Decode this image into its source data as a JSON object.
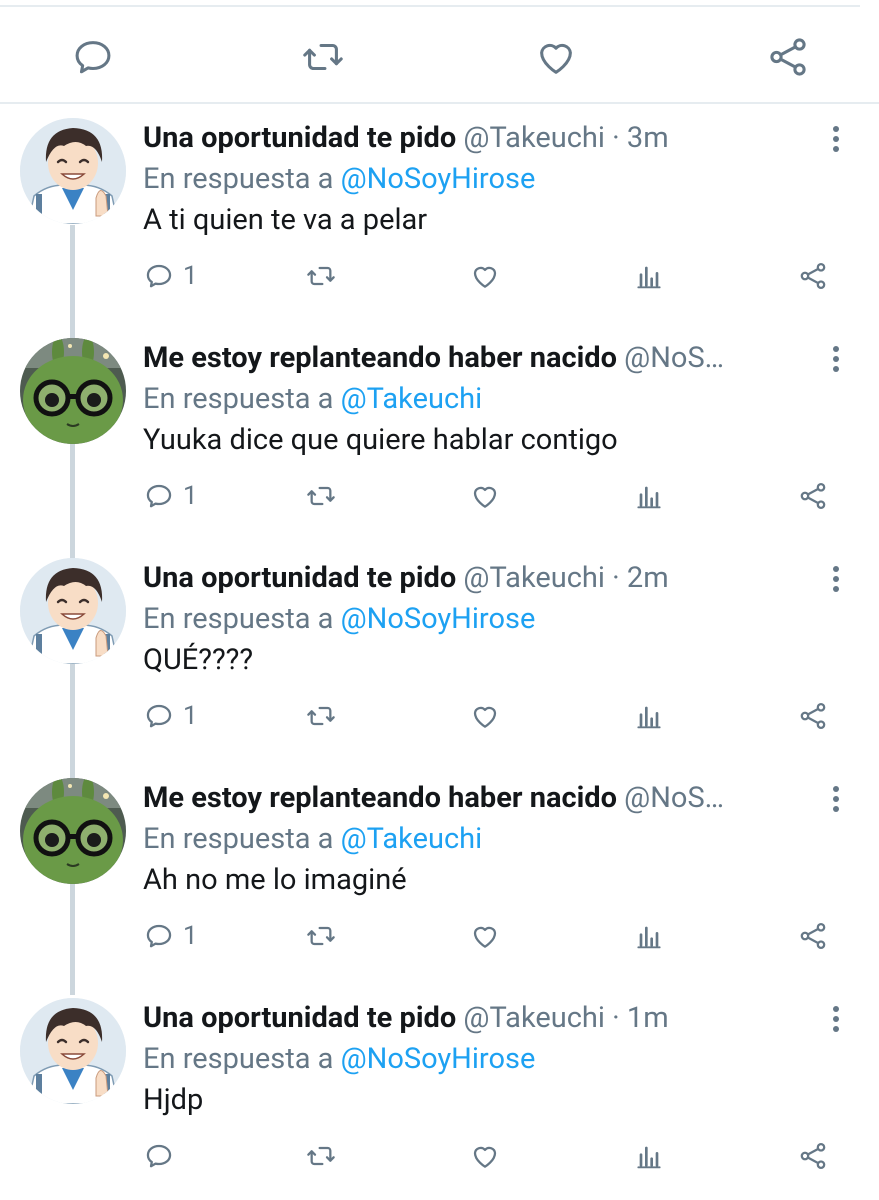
{
  "colors": {
    "accent": "#1da1f2",
    "text": "#14171a",
    "secondary": "#657786",
    "divider": "#e6ecf0",
    "thread_line": "#ccd6dd"
  },
  "top_actions": {
    "icons": [
      "reply-icon",
      "retweet-icon",
      "like-icon",
      "share-icon"
    ]
  },
  "tweets": [
    {
      "avatar": "anime-boy-avatar",
      "name": "Una oportunidad te pido",
      "handle": "@Takeuchi",
      "dot": "·",
      "time": "3m",
      "reply_prefix": "En respuesta a ",
      "reply_mention": "@NoSoyHirose",
      "text": "A ti quien te va a pelar",
      "reply_count": "1"
    },
    {
      "avatar": "green-plush-glasses-avatar",
      "name": "Me estoy replanteando haber nacido",
      "handle": "@NoS…",
      "dot": "",
      "time": "",
      "reply_prefix": "En respuesta a ",
      "reply_mention": "@Takeuchi",
      "text": "Yuuka dice que quiere hablar contigo",
      "reply_count": "1"
    },
    {
      "avatar": "anime-boy-avatar",
      "name": "Una oportunidad te pido",
      "handle": "@Takeuchi",
      "dot": "·",
      "time": "2m",
      "reply_prefix": "En respuesta a ",
      "reply_mention": "@NoSoyHirose",
      "text": "QUÉ????",
      "reply_count": "1"
    },
    {
      "avatar": "green-plush-glasses-avatar",
      "name": "Me estoy replanteando haber nacido",
      "handle": "@NoS…",
      "dot": "",
      "time": "",
      "reply_prefix": "En respuesta a ",
      "reply_mention": "@Takeuchi",
      "text": "Ah no me lo imaginé",
      "reply_count": "1"
    },
    {
      "avatar": "anime-boy-avatar",
      "name": "Una oportunidad te pido",
      "handle": "@Takeuchi",
      "dot": "·",
      "time": "1m",
      "reply_prefix": "En respuesta a ",
      "reply_mention": "@NoSoyHirose",
      "text": "Hjdp",
      "reply_count": ""
    }
  ]
}
